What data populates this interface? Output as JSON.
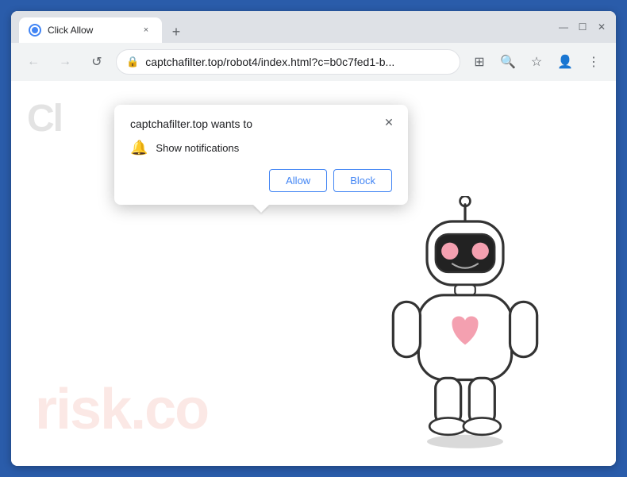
{
  "browser": {
    "window_title": "Click Allow",
    "tab": {
      "title": "Click Allow",
      "close_label": "×"
    },
    "new_tab_label": "+",
    "window_controls": {
      "minimize": "—",
      "maximize": "☐",
      "close": "✕"
    },
    "nav": {
      "back": "←",
      "forward": "→",
      "reload": "↺",
      "address": "captchafilter.top/robot4/index.html?c=b0c7fed1-b...",
      "lock_icon": "🔒"
    }
  },
  "page": {
    "heading_partial": "Cl",
    "watermark": "risk.co"
  },
  "dialog": {
    "title": "captchafilter.top wants to",
    "close_label": "✕",
    "permission_label": "Show notifications",
    "allow_button": "Allow",
    "block_button": "Block"
  }
}
